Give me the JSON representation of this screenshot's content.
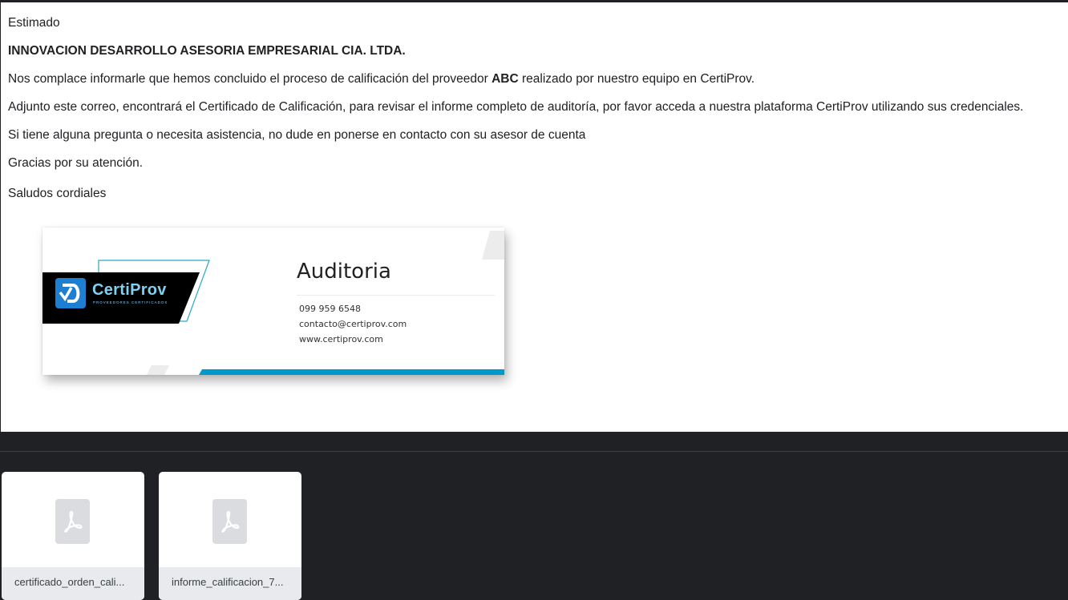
{
  "email": {
    "greeting": "Estimado",
    "company": "INNOVACION DESARROLLO ASESORIA EMPRESARIAL CIA. LTDA.",
    "p1_before": "Nos complace informarle que hemos concluido el proceso de calificación del proveedor ",
    "p1_bold": "ABC",
    "p1_after": " realizado por nuestro equipo en CertiProv.",
    "p2": "Adjunto este correo, encontrará el Certificado de Calificación, para revisar el informe completo de auditoría, por favor acceda a nuestra plataforma CertiProv utilizando sus credenciales.",
    "p3": "Si tiene alguna pregunta o necesita asistencia, no dude en ponerse en contacto con su asesor de cuenta",
    "p4": "Gracias por su atención.",
    "closing": "Saludos cordiales"
  },
  "signature": {
    "logo_text": "CertiProv",
    "logo_tagline": "PROVEEDORES CERTIFICADOS",
    "title": "Auditoria",
    "phone": "099 959 6548",
    "email": "contacto@certiprov.com",
    "website": "www.certiprov.com",
    "colors": {
      "accent": "#0099cc",
      "logo_block": "#000000",
      "logo_mark": "#1c7fd1",
      "logo_text": "#7ed1f2"
    }
  },
  "attachments": [
    {
      "name": "certificado_orden_cali...",
      "icon": "pdf-icon"
    },
    {
      "name": "informe_calificacion_7...",
      "icon": "pdf-icon"
    }
  ],
  "colors": {
    "background": "#202124",
    "body": "#ffffff",
    "attachment_bar": "#e8eaed",
    "icon_bg": "#dadce0"
  }
}
